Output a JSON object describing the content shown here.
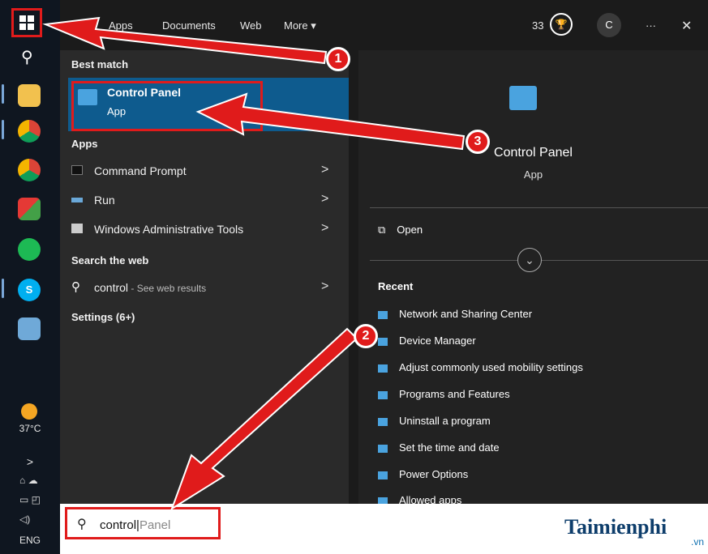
{
  "taskbar": {
    "temperature": "37°C",
    "language": "ENG",
    "more_chevron": ">"
  },
  "top_bar": {
    "tabs": [
      "Apps",
      "Documents",
      "Web",
      "More ▾"
    ],
    "points": "33",
    "avatar_letter": "C",
    "ellipsis": "···",
    "close": "✕"
  },
  "results": {
    "best_match_title": "Best match",
    "best_match": {
      "name": "Control Panel",
      "type": "App"
    },
    "apps_title": "Apps",
    "apps": [
      {
        "label": "Command Prompt",
        "chevron": ">"
      },
      {
        "label": "Run",
        "chevron": ">"
      },
      {
        "label": "Windows Administrative Tools",
        "chevron": ">"
      }
    ],
    "web_title": "Search the web",
    "web_result": {
      "query": "control",
      "suffix": " - See web results",
      "chevron": ">"
    },
    "settings_title": "Settings (6+)"
  },
  "detail": {
    "title": "Control Panel",
    "subtitle": "App",
    "open_label": "Open",
    "expand_glyph": "⌄",
    "recent_title": "Recent",
    "recent": [
      "Network and Sharing Center",
      "Device Manager",
      "Adjust commonly used mobility settings",
      "Programs and Features",
      "Uninstall a program",
      "Set the time and date",
      "Power Options",
      "Allowed apps"
    ]
  },
  "search": {
    "typed": "control",
    "placeholder_rest": "Panel"
  },
  "annotations": {
    "badges": [
      "1",
      "2",
      "3"
    ]
  },
  "watermark": {
    "text": "Taimienphi",
    "sub": ".vn"
  },
  "colors": {
    "highlight_border": "#e01b1b",
    "selection_bg": "#0e5b8e"
  }
}
